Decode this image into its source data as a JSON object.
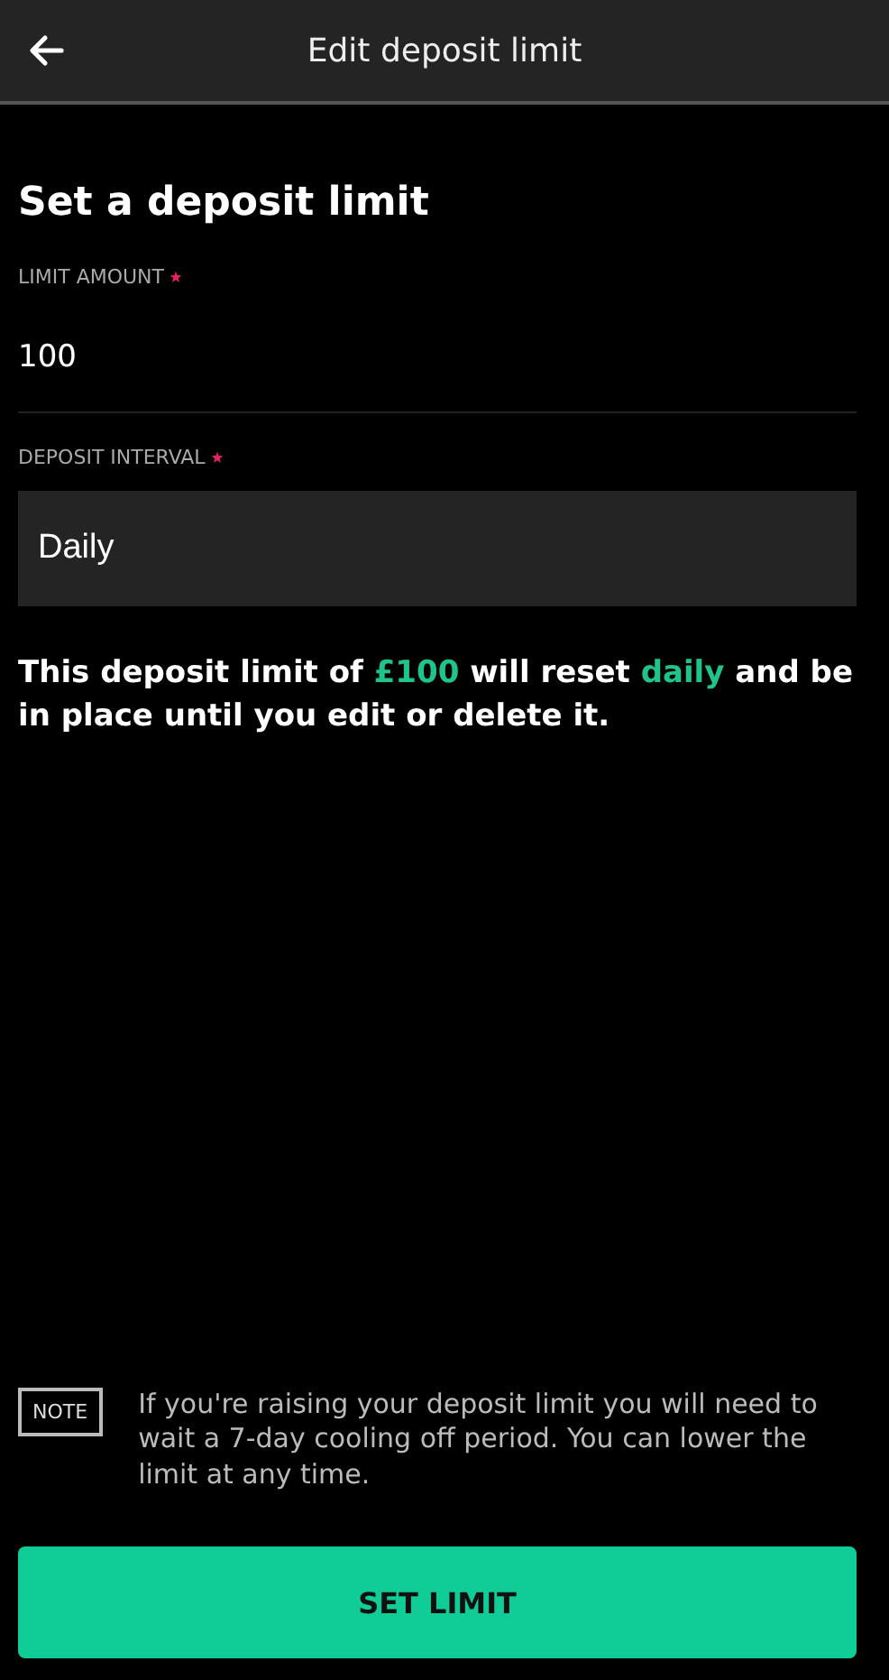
{
  "header": {
    "title": "Edit deposit limit"
  },
  "heading": "Set a deposit limit",
  "fields": [
    {
      "kind": "text",
      "label": "LIMIT AMOUNT",
      "required": true,
      "value": "100"
    },
    {
      "kind": "select",
      "label": "DEPOSIT INTERVAL",
      "required": true,
      "value": "Daily"
    }
  ],
  "summary": [
    {
      "text": "This deposit limit of ",
      "highlight": false
    },
    {
      "text": "£100",
      "highlight": true
    },
    {
      "text": " will reset ",
      "highlight": false
    },
    {
      "text": "daily",
      "highlight": true
    },
    {
      "text": " and be in place until you edit or delete it.",
      "highlight": false
    }
  ],
  "note": {
    "tag": "NOTE",
    "text": "If you're raising your deposit limit you will need to wait a 7-day cooling off period. You can lower the limit at any time."
  },
  "button": "SET LIMIT"
}
